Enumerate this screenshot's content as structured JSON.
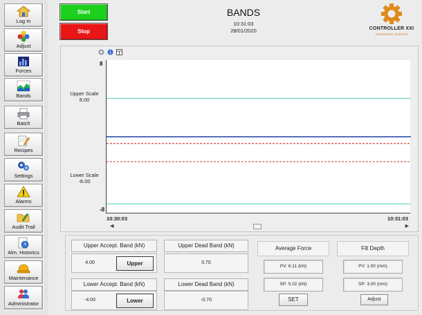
{
  "sidebar": {
    "items": [
      {
        "label": "Log In",
        "icon": "home-icon"
      },
      {
        "label": "Adjust",
        "icon": "flower-icon"
      },
      {
        "label": "Forces",
        "icon": "bar-chart-icon"
      },
      {
        "label": "Bands",
        "icon": "area-chart-icon"
      },
      {
        "label": "Batch",
        "icon": "printer-icon"
      },
      {
        "label": "Recipes",
        "icon": "document-pencil-icon"
      },
      {
        "label": "Settings",
        "icon": "gears-icon"
      },
      {
        "label": "Alarms",
        "icon": "warning-icon"
      },
      {
        "label": "Audit Trail",
        "icon": "folder-pencil-icon"
      },
      {
        "label": "Alm. Historics",
        "icon": "history-icon"
      },
      {
        "label": "Maintenance",
        "icon": "hardhat-icon"
      },
      {
        "label": "Administrator",
        "icon": "users-icon"
      }
    ]
  },
  "header": {
    "start_label": "Start",
    "stop_label": "Stop",
    "title": "BANDS",
    "time": "10:31:03",
    "date": "28/01/2020",
    "logo_text": "CONTROLLER XXI",
    "logo_sub": "Automation Systems",
    "colors": {
      "start": "#1ed01e",
      "stop": "#e81616",
      "logo": "#e08a1a"
    }
  },
  "chart": {
    "y_top": "8",
    "y_bottom": "-8",
    "upper_scale_label": "Upper Scale",
    "upper_scale_value": "8.00",
    "lower_scale_label": "Lower Scale",
    "lower_scale_value": "-8.00",
    "x_start": "10:30:03",
    "x_end": "10:31:03"
  },
  "chart_data": {
    "type": "line",
    "ylim": [
      -8,
      8
    ],
    "x": [
      "10:30:03",
      "10:31:03"
    ],
    "lines": [
      {
        "role": "upper-accept-band",
        "value": 4.0,
        "color": "#6ad6c4",
        "style": "solid"
      },
      {
        "role": "force",
        "value": 0.0,
        "color": "#1e3fa0",
        "style": "solid"
      },
      {
        "role": "upper-dead-band",
        "value": -0.7,
        "color": "#d64040",
        "style": "dashed"
      },
      {
        "role": "lower-dead-band",
        "value": -2.6,
        "color": "#d64040",
        "style": "dashed"
      },
      {
        "role": "lower-accept-band",
        "value": -7.0,
        "color": "#6ad6c4",
        "style": "solid"
      }
    ],
    "xlabel": "",
    "ylabel": ""
  },
  "bands": {
    "upper_accept_label": "Upper Accept. Band (kN)",
    "upper_accept_value": "4.00",
    "upper_button": "Upper",
    "upper_dead_label": "Upper Dead Band (kN)",
    "upper_dead_value": "0.70",
    "lower_accept_label": "Lower Accept. Band (kN)",
    "lower_accept_value": "-4.00",
    "lower_button": "Lower",
    "lower_dead_label": "Lower Dead Band (kN)",
    "lower_dead_value": "-0.70"
  },
  "average_force": {
    "label": "Average Force",
    "pv": "PV:  6.11  (kN)",
    "sp": "SP:  5.02  (kN)",
    "button": "SET"
  },
  "fill_depth": {
    "label": "Fill Depth",
    "pv": "PV:  1.00  (mm)",
    "sp": "SP:  3.00  (mm)",
    "button": "Adjust"
  }
}
